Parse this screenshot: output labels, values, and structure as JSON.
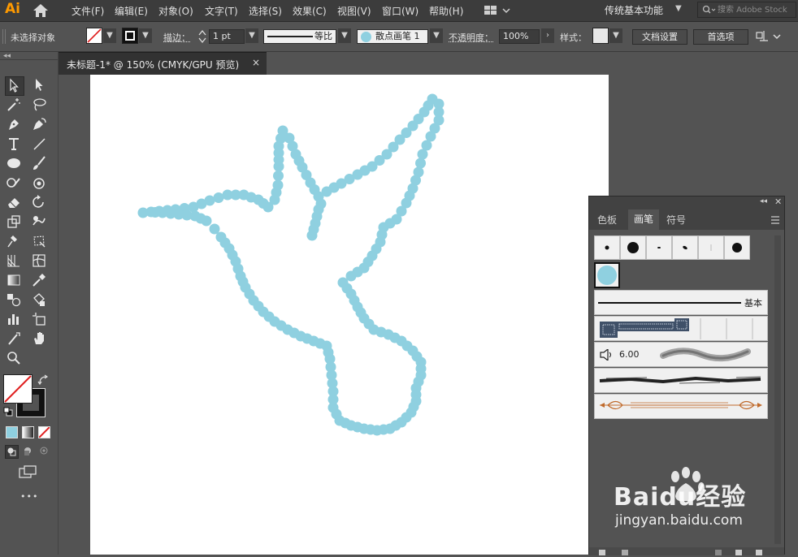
{
  "app": {
    "logo": "Ai",
    "menus": [
      "文件(F)",
      "编辑(E)",
      "对象(O)",
      "文字(T)",
      "选择(S)",
      "效果(C)",
      "视图(V)",
      "窗口(W)",
      "帮助(H)"
    ],
    "workspace": "传统基本功能",
    "search_placeholder": "搜索 Adobe Stock"
  },
  "control_bar": {
    "selection_status": "未选择对象",
    "stroke_label": "描边：",
    "stroke_weight": "1 pt",
    "stroke_profile": "等比",
    "brush_name": "散点画笔 1",
    "opacity_label": "不透明度：",
    "opacity_value": "100%",
    "style_label": "样式：",
    "doc_setup_button": "文档设置",
    "preferences_button": "首选项"
  },
  "document": {
    "tab_title": "未标题-1* @ 150% (CMYK/GPU 预览)",
    "close_glyph": "×"
  },
  "brushes_panel": {
    "tabs": [
      "色板",
      "画笔",
      "符号"
    ],
    "active_tab": "画笔",
    "basic_label": "基本",
    "bristle_size": "6.00",
    "scatter_color": "#8fd0e0"
  },
  "toolbar": {
    "more_glyph": "•••"
  },
  "watermark": {
    "text": "Baidu经验",
    "url": "jingyan.baidu.com"
  },
  "colors": {
    "bird_dots": "#8fd0e0",
    "accent_orange": "#ff9a00"
  }
}
